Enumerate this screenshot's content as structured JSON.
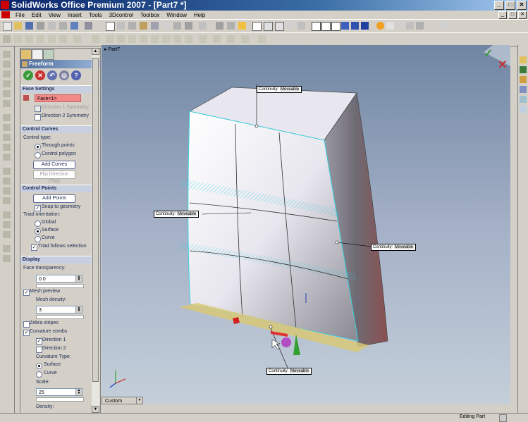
{
  "window": {
    "title": "SolidWorks Office Premium 2007 - [Part7 *]",
    "buttons": [
      "_",
      "□",
      "✕"
    ]
  },
  "menubar": {
    "items": [
      "File",
      "Edit",
      "View",
      "Insert",
      "Tools",
      "3Dcontrol",
      "Toolbox",
      "Window",
      "Help"
    ]
  },
  "property_manager": {
    "title": "Freeform",
    "face_settings": {
      "title": "Face Settings",
      "face_value": "Face<1>",
      "dir1_symmetry": "Direction 1 Symmetry",
      "dir2_symmetry": "Direction 2 Symmetry"
    },
    "control_curves": {
      "title": "Control Curves",
      "control_type_label": "Control type:",
      "through_points": "Through points",
      "control_polygon": "Control polygon",
      "add_curves": "Add Curves",
      "flip_direction": "Flip Direction (Tab)"
    },
    "control_points": {
      "title": "Control Points",
      "add_points": "Add Points",
      "snap_to_geometry": "Snap to geometry",
      "triad_orientation": "Triad orientation:",
      "global": "Global",
      "surface": "Surface",
      "curve": "Curve",
      "triad_follows": "Triad follows selection"
    },
    "display": {
      "title": "Display",
      "face_transparency": "Face transparency:",
      "transparency_value": "0.0",
      "mesh_preview": "Mesh preview",
      "mesh_density": "Mesh density:",
      "mesh_density_value": "3",
      "zebra_stripes": "Zebra stripes",
      "curvature_combs": "Curvature combs",
      "direction1": "Direction 1",
      "direction2": "Direction 2",
      "curvature_type": "Curvature Type:",
      "surface": "Surface",
      "curve": "Curve",
      "scale": "Scale:",
      "scale_value": "25",
      "density": "Density:"
    }
  },
  "viewport": {
    "tree_label": "Part7",
    "callouts": [
      {
        "label": "Continuity:",
        "value": "Moveable"
      },
      {
        "label": "Continuity:",
        "value": "Moveable"
      },
      {
        "label": "Continuity:",
        "value": "Moveable"
      },
      {
        "label": "Continuity:",
        "value": "Moveable"
      }
    ],
    "view_combo": "Custom"
  },
  "statusbar": {
    "text": "Editing Part"
  },
  "colors": {
    "accent_title": "#0a246a",
    "viewport_bg": "#8fa0b8",
    "face_highlight": "#f28a8a"
  }
}
